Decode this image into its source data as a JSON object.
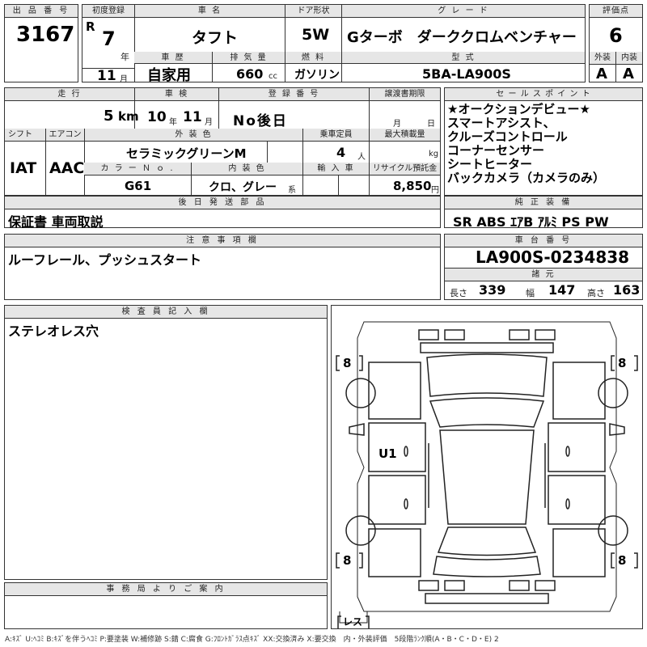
{
  "header": {
    "lot_label": "出 品 番 号",
    "lot_number": "3167",
    "first_reg_label": "初度登録",
    "era": "R",
    "year": "7",
    "year_unit": "年",
    "month": "11",
    "month_unit": "月",
    "car_name_label": "車 名",
    "car_name": "タフト",
    "door_label": "ドア形状",
    "door": "5W",
    "grade_label": "グ レ ー ド",
    "grade": "Gターボ　ダーククロムベンチャー",
    "score_label": "評価点",
    "score": "6",
    "history_label": "車 歴",
    "history": "自家用",
    "displacement_label": "排 気 量",
    "displacement": "660",
    "displacement_unit": "cc",
    "fuel_label": "燃 料",
    "fuel": "ガソリン",
    "model_label": "型 式",
    "model": "5BA-LA900S",
    "exterior_label": "外装",
    "exterior": "A",
    "interior_label": "内装",
    "interior": "A"
  },
  "row2": {
    "mileage_label": "走 行",
    "mileage": "5",
    "mileage_unit": "km",
    "inspection_label": "車 検",
    "insp_year": "10",
    "insp_year_unit": "年",
    "insp_month": "11",
    "insp_month_unit": "月",
    "reg_label": "登 録 番 号",
    "reg": "No後日",
    "transfer_label": "譲渡書期限",
    "transfer_month_unit": "月",
    "transfer_day_unit": "日",
    "shift_label": "シフト",
    "shift": "IAT",
    "ac_label": "エアコン",
    "ac": "AAC",
    "color_label": "外 装 色",
    "color": "セラミックグリーンM",
    "capacity_label": "乗車定員",
    "capacity": "4",
    "capacity_unit": "人",
    "load_label": "最大積載量",
    "load_unit": "kg",
    "color_no_label": "カ ラ ー Ｎ ｏ .",
    "color_no": "G61",
    "interior_color_label": "内 装 色",
    "interior_color": "クロ、グレー",
    "interior_color_unit": "系",
    "import_label": "輸 入 車",
    "recycle_label": "リサイクル預託金",
    "recycle": "8,850",
    "recycle_unit": "円"
  },
  "sales_points": {
    "label": "セ ー ル ス ポ イ ン ト",
    "lines": [
      "★オークションデビュー★",
      "スマートアシスト、",
      "クルーズコントロール",
      "コーナーセンサー",
      "シートヒーター",
      "バックカメラ（カメラのみ）"
    ]
  },
  "later_parts": {
    "label": "後 日 発 送 部 品",
    "value": "保証書 車両取説"
  },
  "equipment": {
    "label": "純 正 装 備",
    "value": "SR  ABS  ｴｱB  ｱﾙﾐ  PS  PW"
  },
  "notes": {
    "label": "注 意 事 項 欄",
    "value": "ルーフレール、プッシュスタート"
  },
  "chassis": {
    "label": "車 台 番 号",
    "value": "LA900S-0234838",
    "dims_label": "諸 元",
    "length_label": "長さ",
    "length": "339",
    "width_label": "幅",
    "width": "147",
    "height_label": "高さ",
    "height": "163"
  },
  "inspector": {
    "label": "検 査 員 記 入 欄",
    "value": "ステレオレス穴"
  },
  "office": {
    "label": "事 務 局 よ り ご 案 内"
  },
  "diagram": {
    "tire_fl": "8",
    "tire_fr": "8",
    "tire_rl": "8",
    "tire_rr": "8",
    "spare": "レス",
    "mark_u1": "U1"
  },
  "legend": "A:ｷｽﾞ U:ﾍｺﾐ B:ｷｽﾞを伴うﾍｺﾐ P:要塗装 W:補修跡 S:錆 C:腐食 G:ﾌﾛﾝﾄｶﾞﾗｽ点ｷｽﾞ XX:交換済み X:要交換　内・外装評価　5段階ﾗﾝｸ順(A・B・C・D・E) 2"
}
